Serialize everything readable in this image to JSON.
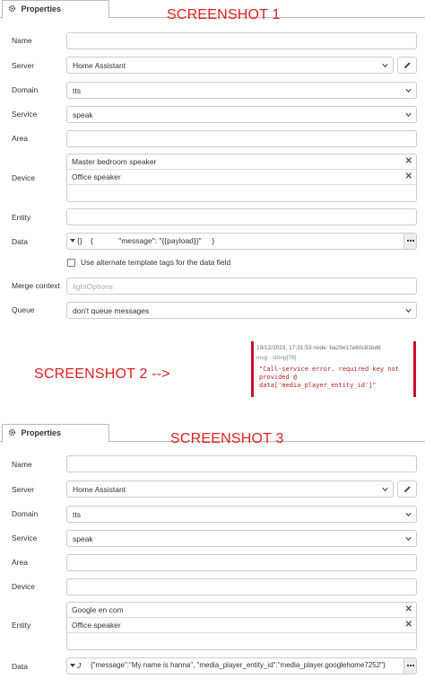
{
  "panel_tab_label": "Properties",
  "screenshots": {
    "one": "SCREENSHOT 1",
    "two": "SCREENSHOT 2 -->",
    "three": "SCREENSHOT 3"
  },
  "form1": {
    "labels": {
      "name": "Name",
      "server": "Server",
      "domain": "Domain",
      "service": "Service",
      "area": "Area",
      "device": "Device",
      "entity": "Entity",
      "data": "Data",
      "merge_context": "Merge context",
      "queue": "Queue"
    },
    "name_value": "",
    "server_value": "Home Assistant",
    "domain_value": "tts",
    "service_value": "speak",
    "area_value": "",
    "devices": [
      "Master bedroom speaker",
      "Office speaker"
    ],
    "entity_value": "",
    "data_type": "{}",
    "data_value": "{            \"message\": \"{{payload}}\"     }",
    "alt_template_label": "Use alternate template tags for the data field",
    "merge_context_placeholder": "lightOptions",
    "queue_value": "don't queue messages"
  },
  "debug_message": {
    "timestamp_node": "19/12/2023, 17:31:53   node: ba29e17e60c81bd6",
    "type_line": "msg : string[78]",
    "text": "\"Call-service error. required key not provided @ data['media_player_entity_id']\""
  },
  "form2": {
    "labels": {
      "name": "Name",
      "server": "Server",
      "domain": "Domain",
      "service": "Service",
      "area": "Area",
      "device": "Device",
      "entity": "Entity",
      "data": "Data"
    },
    "server_value": "Home Assistant",
    "domain_value": "tts",
    "service_value": "speak",
    "entities": [
      "Google en com",
      "Office speaker"
    ],
    "data_type": "J",
    "data_value": "{\"message\":\"My name is hanna\", \"media_player_entity_id\":\"media_player.googlehome7252\"}"
  },
  "colors": {
    "annotation": "#e02020",
    "debug_border": "#c8102e"
  }
}
